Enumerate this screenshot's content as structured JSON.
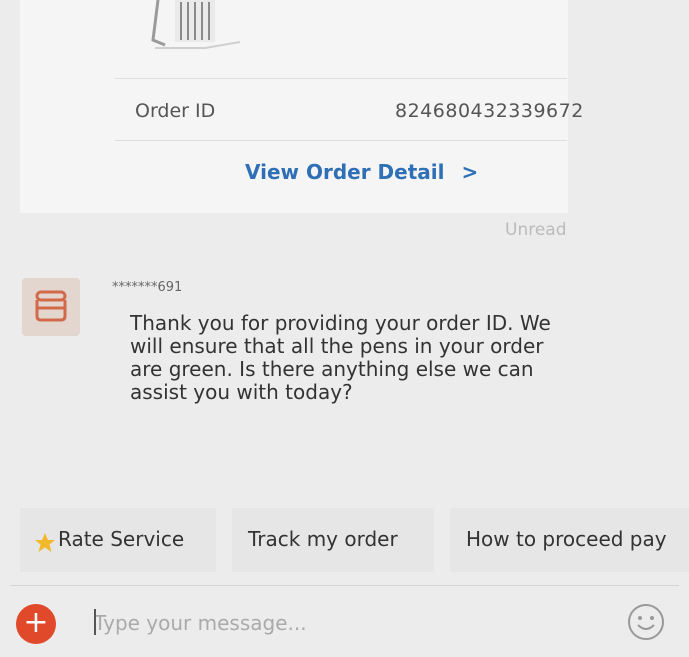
{
  "order": {
    "label": "Order ID",
    "value": "824680432339672",
    "view_detail": "View Order Detail",
    "chevron": ">"
  },
  "status": {
    "unread": "Unread"
  },
  "message": {
    "sender": "*******691",
    "text": "Thank you for providing your order ID. We will ensure that all the pens in your order are green. Is there anything else we can assist you with today?"
  },
  "quick_replies": [
    {
      "label": "Rate Service",
      "icon": "star-icon"
    },
    {
      "label": "Track my order"
    },
    {
      "label": "How to proceed pay"
    }
  ],
  "composer": {
    "placeholder": "Type your message...",
    "plus_icon": "plus-icon",
    "emoji_icon": "smiley-icon"
  },
  "colors": {
    "link": "#2f6fb5",
    "plus": "#e1492b",
    "star": "#f2b92e",
    "avatar": "#d2694a"
  }
}
